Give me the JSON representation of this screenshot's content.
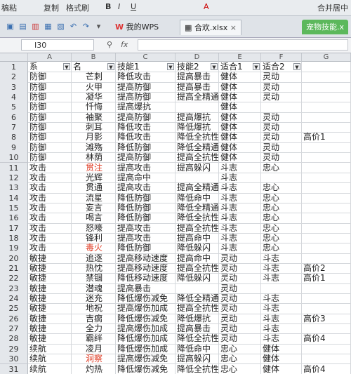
{
  "ribbon": {
    "items": [
      "稿粘",
      "复制",
      "格式刷",
      "B",
      "I",
      "U",
      "A",
      "合并居中"
    ]
  },
  "tabs": {
    "wps": "我的WPS",
    "file": "合欢.xlsx",
    "extra": "宠物技能.x"
  },
  "formula": {
    "cellref": "I30",
    "fx": "fx"
  },
  "columns": [
    "A",
    "B",
    "C",
    "D",
    "E",
    "F",
    "G"
  ],
  "headers": {
    "A": "系",
    "B": "名",
    "C": "技能1",
    "D": "技能2",
    "E": "适合1",
    "F": "适合2"
  },
  "rows": [
    {
      "n": "1",
      "a": "系",
      "b": "名",
      "c": "技能1",
      "d": "技能2",
      "e": "适合1",
      "f": "适合2",
      "g": ""
    },
    {
      "n": "2",
      "a": "防御",
      "b": "芒刺",
      "c": "降低攻击",
      "d": "提高暴击",
      "e": "健体",
      "f": "灵动",
      "g": ""
    },
    {
      "n": "3",
      "a": "防御",
      "b": "火甲",
      "c": "提高防御",
      "d": "提高暴击",
      "e": "健体",
      "f": "灵动",
      "g": ""
    },
    {
      "n": "4",
      "a": "防御",
      "b": "凝华",
      "c": "提高防御",
      "d": "提高全精通",
      "e": "健体",
      "f": "灵动",
      "g": ""
    },
    {
      "n": "5",
      "a": "防御",
      "b": "忏悔",
      "c": "提高爆抗",
      "d": "",
      "e": "健体",
      "f": "",
      "g": ""
    },
    {
      "n": "6",
      "a": "防御",
      "b": "袖聚",
      "c": "提高防御",
      "d": "提高爆抗",
      "e": "健体",
      "f": "灵动",
      "g": ""
    },
    {
      "n": "7",
      "a": "防御",
      "b": "刺耳",
      "c": "降低攻击",
      "d": "降低爆抗",
      "e": "健体",
      "f": "灵动",
      "g": ""
    },
    {
      "n": "8",
      "a": "防御",
      "b": "月影",
      "c": "降低攻击",
      "d": "降低全抗性",
      "e": "健体",
      "f": "灵动",
      "g": "高价1"
    },
    {
      "n": "9",
      "a": "防御",
      "b": "滩殇",
      "c": "降低防御",
      "d": "降低全精通",
      "e": "健体",
      "f": "灵动",
      "g": ""
    },
    {
      "n": "10",
      "a": "防御",
      "b": "林荫",
      "c": "提高防御",
      "d": "提高全抗性",
      "e": "健体",
      "f": "灵动",
      "g": ""
    },
    {
      "n": "11",
      "a": "攻击",
      "b": "贯注",
      "c": "提高攻击",
      "d": "提高躲闪",
      "e": "斗志",
      "f": "忠心",
      "g": "",
      "redB": true
    },
    {
      "n": "12",
      "a": "攻击",
      "b": "光辉",
      "c": "提高命中",
      "d": "",
      "e": "斗志",
      "f": "",
      "g": ""
    },
    {
      "n": "13",
      "a": "攻击",
      "b": "贯通",
      "c": "提高攻击",
      "d": "提高全精通",
      "e": "斗志",
      "f": "忠心",
      "g": ""
    },
    {
      "n": "14",
      "a": "攻击",
      "b": "流星",
      "c": "降低防御",
      "d": "降低命中",
      "e": "斗志",
      "f": "忠心",
      "g": ""
    },
    {
      "n": "15",
      "a": "攻击",
      "b": "妄言",
      "c": "降低防御",
      "d": "降低全精通",
      "e": "斗志",
      "f": "忠心",
      "g": ""
    },
    {
      "n": "16",
      "a": "攻击",
      "b": "喝言",
      "c": "降低防御",
      "d": "降低全抗性",
      "e": "斗志",
      "f": "忠心",
      "g": ""
    },
    {
      "n": "17",
      "a": "攻击",
      "b": "怒嚎",
      "c": "提高攻击",
      "d": "提高全抗性",
      "e": "斗志",
      "f": "忠心",
      "g": ""
    },
    {
      "n": "18",
      "a": "攻击",
      "b": "锋利",
      "c": "提高攻击",
      "d": "提高命中",
      "e": "斗志",
      "f": "忠心",
      "g": ""
    },
    {
      "n": "19",
      "a": "攻击",
      "b": "毒火",
      "c": "降低防御",
      "d": "降低躲闪",
      "e": "斗志",
      "f": "忠心",
      "g": "",
      "redB": true
    },
    {
      "n": "20",
      "a": "敏捷",
      "b": "追逐",
      "c": "提高移动速度",
      "d": "提高命中",
      "e": "灵动",
      "f": "斗志",
      "g": ""
    },
    {
      "n": "21",
      "a": "敏捷",
      "b": "热忱",
      "c": "提高移动速度",
      "d": "提高全抗性",
      "e": "灵动",
      "f": "斗志",
      "g": "高价2"
    },
    {
      "n": "22",
      "a": "敏捷",
      "b": "禁锢",
      "c": "降低移动速度",
      "d": "降低躲闪",
      "e": "灵动",
      "f": "斗志",
      "g": "高价1"
    },
    {
      "n": "23",
      "a": "敏捷",
      "b": "潜魂",
      "c": "提高暴击",
      "d": "",
      "e": "灵动",
      "f": "",
      "g": ""
    },
    {
      "n": "24",
      "a": "敏捷",
      "b": "迷充",
      "c": "降低爆伤减免",
      "d": "降低全精通",
      "e": "灵动",
      "f": "斗志",
      "g": ""
    },
    {
      "n": "25",
      "a": "敏捷",
      "b": "地祝",
      "c": "提高爆伤加成",
      "d": "提高全抗性",
      "e": "灵动",
      "f": "斗志",
      "g": ""
    },
    {
      "n": "26",
      "a": "敏捷",
      "b": "吉瘸",
      "c": "降低爆伤减免",
      "d": "降低爆抗",
      "e": "灵动",
      "f": "斗志",
      "g": "高价3"
    },
    {
      "n": "27",
      "a": "敏捷",
      "b": "全力",
      "c": "提高爆伤加成",
      "d": "提高暴击",
      "e": "灵动",
      "f": "斗志",
      "g": ""
    },
    {
      "n": "28",
      "a": "敏捷",
      "b": "霸绊",
      "c": "降低爆伤加成",
      "d": "降低全抗性",
      "e": "灵动",
      "f": "斗志",
      "g": "高价4"
    },
    {
      "n": "29",
      "a": "续航",
      "b": "凌月",
      "c": "降低爆伤加成",
      "d": "降低命中",
      "e": "忠心",
      "f": "健体",
      "g": ""
    },
    {
      "n": "30",
      "a": "续航",
      "b": "洞察",
      "c": "提高爆伤减免",
      "d": "提高躲闪",
      "e": "忠心",
      "f": "健体",
      "g": "",
      "redB": true
    },
    {
      "n": "31",
      "a": "续航",
      "b": "灼热",
      "c": "降低爆伤减免",
      "d": "降低全抗性",
      "e": "忠心",
      "f": "健体",
      "g": "高价4"
    }
  ],
  "side_marks": [
    "练",
    "90"
  ],
  "colors": {
    "red_text": "#e0402a",
    "header_bg": "#e4e7eb",
    "tab_green": "#5cb85c"
  }
}
